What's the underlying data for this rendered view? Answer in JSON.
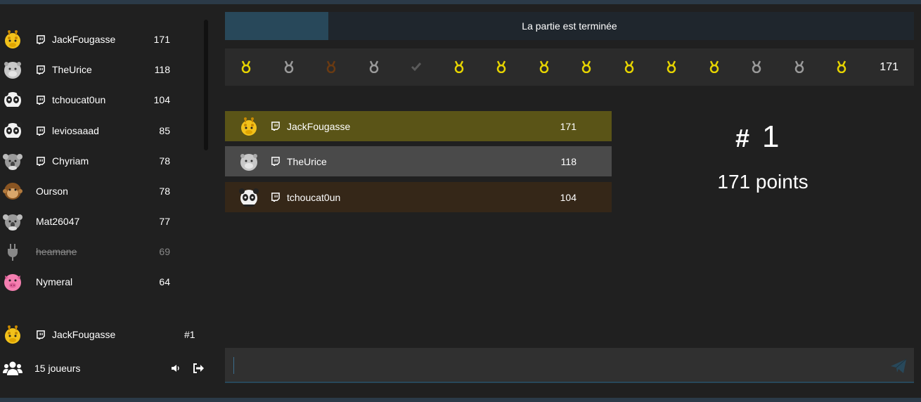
{
  "colors": {
    "accent": "#28485a",
    "gold_row": "#5a5417",
    "silver_row": "#4a4a4a",
    "bronze_row": "#352718",
    "medal_gold": "#e6d400",
    "medal_silver": "#9a9a9a",
    "medal_bronze": "#6a3a12"
  },
  "sidebar": {
    "players": [
      {
        "name": "JackFougasse",
        "score": "171",
        "avatar": "giraffe-icon",
        "twitch": true,
        "disconnected": false
      },
      {
        "name": "TheUrice",
        "score": "118",
        "avatar": "rhino-icon",
        "twitch": true,
        "disconnected": false
      },
      {
        "name": "tchoucat0un",
        "score": "104",
        "avatar": "panda-icon",
        "twitch": true,
        "disconnected": false
      },
      {
        "name": "leviosaaad",
        "score": "85",
        "avatar": "panda-icon",
        "twitch": true,
        "disconnected": false
      },
      {
        "name": "Chyriam",
        "score": "78",
        "avatar": "koala-icon",
        "twitch": true,
        "disconnected": false
      },
      {
        "name": "Ourson",
        "score": "78",
        "avatar": "monkey-icon",
        "twitch": false,
        "disconnected": false
      },
      {
        "name": "Mat26047",
        "score": "77",
        "avatar": "koala-icon",
        "twitch": false,
        "disconnected": false
      },
      {
        "name": "heamane",
        "score": "69",
        "avatar": "plug-icon",
        "twitch": false,
        "disconnected": true
      },
      {
        "name": "Nymeral",
        "score": "64",
        "avatar": "pig-icon",
        "twitch": false,
        "disconnected": false
      }
    ],
    "me": {
      "name": "JackFougasse",
      "rank": "#1",
      "avatar": "giraffe-icon"
    },
    "player_count": "15 joueurs"
  },
  "status": {
    "text": "La partie est terminée",
    "progress": 0.15
  },
  "rounds": {
    "results": [
      "gold",
      "silver",
      "bronze",
      "silver",
      "check",
      "gold",
      "gold",
      "gold",
      "gold",
      "gold",
      "gold",
      "gold",
      "silver",
      "silver",
      "gold"
    ],
    "total": "171"
  },
  "podium": [
    {
      "name": "JackFougasse",
      "score": "171",
      "avatar": "giraffe-icon"
    },
    {
      "name": "TheUrice",
      "score": "118",
      "avatar": "rhino-icon"
    },
    {
      "name": "tchoucat0un",
      "score": "104",
      "avatar": "panda-icon"
    }
  ],
  "result": {
    "hash": "#",
    "rank": "1",
    "points": "171 points"
  },
  "chat": {
    "value": "",
    "placeholder": ""
  }
}
